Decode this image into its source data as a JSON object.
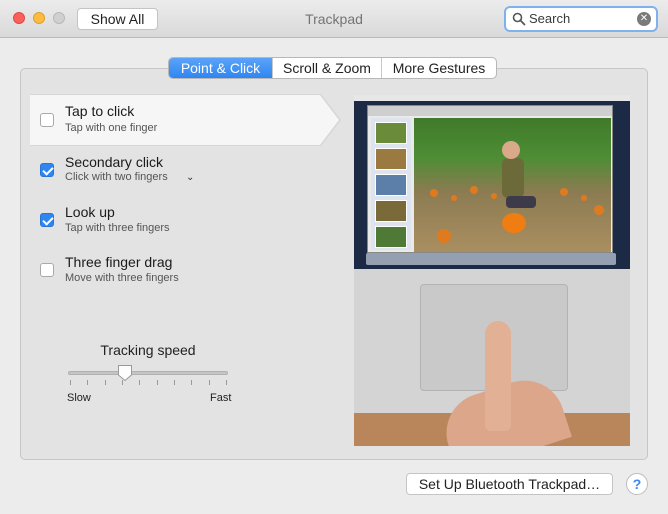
{
  "window": {
    "title": "Trackpad",
    "show_all_label": "Show All"
  },
  "search": {
    "value": "Search"
  },
  "tabs": [
    {
      "label": "Point & Click",
      "active": true
    },
    {
      "label": "Scroll & Zoom",
      "active": false
    },
    {
      "label": "More Gestures",
      "active": false
    }
  ],
  "options": [
    {
      "title": "Tap to click",
      "subtitle": "Tap with one finger",
      "checked": false,
      "selected": true
    },
    {
      "title": "Secondary click",
      "subtitle": "Click with two fingers",
      "checked": true,
      "selected": false,
      "has_dropdown": true
    },
    {
      "title": "Look up",
      "subtitle": "Tap with three fingers",
      "checked": true,
      "selected": false
    },
    {
      "title": "Three finger drag",
      "subtitle": "Move with three fingers",
      "checked": false,
      "selected": false
    }
  ],
  "tracking": {
    "label": "Tracking speed",
    "min_label": "Slow",
    "max_label": "Fast",
    "value_fraction": 0.35,
    "tick_count": 10
  },
  "footer": {
    "bluetooth_label": "Set Up Bluetooth Trackpad…",
    "help_label": "?"
  },
  "colors": {
    "accent": "#2f86f1",
    "close": "#fc605c",
    "minimize": "#fdbc40",
    "zoom_disabled": "#d0d0d0"
  }
}
